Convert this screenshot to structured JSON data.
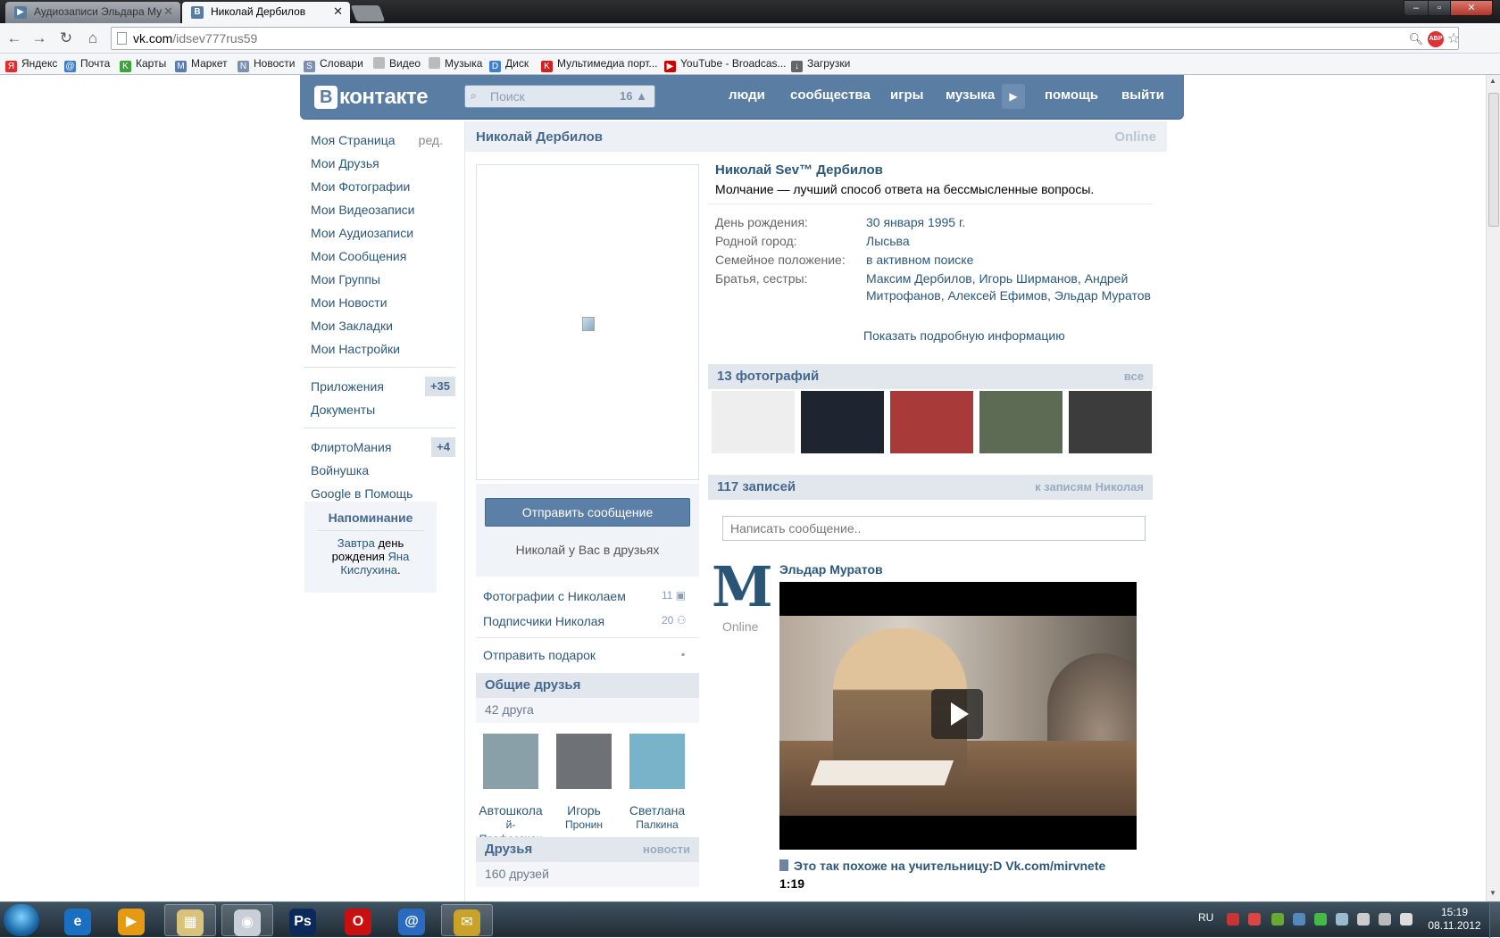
{
  "browser": {
    "tabs": [
      {
        "title": "Аудиозаписи Эльдара Му",
        "favicon": "play-favicon"
      },
      {
        "title": "Николай Дербилов",
        "favicon": "vk-favicon"
      }
    ],
    "nav": {
      "back": "←",
      "forward": "→",
      "reload": "↻",
      "home": "⌂"
    },
    "url": {
      "host": "vk.com",
      "path": "/idsev777rus59"
    },
    "bookmarks": [
      {
        "label": "Яндекс",
        "color": "#e32b2b",
        "glyph": "Я"
      },
      {
        "label": "Почта",
        "color": "#3d7fd1",
        "glyph": "@"
      },
      {
        "label": "Карты",
        "color": "#3aa33a",
        "glyph": "K"
      },
      {
        "label": "Маркет",
        "color": "#5b7ab0",
        "glyph": "M"
      },
      {
        "label": "Новости",
        "color": "#7c8fb0",
        "glyph": "N"
      },
      {
        "label": "Словари",
        "color": "#7c8fb0",
        "glyph": "S"
      },
      {
        "label": "Видео",
        "color": "#bbbbbb",
        "glyph": ""
      },
      {
        "label": "Музыка",
        "color": "#bbbbbb",
        "glyph": ""
      },
      {
        "label": "Диск",
        "color": "#3d7fd1",
        "glyph": "D"
      },
      {
        "label": "Мультимедиа порт...",
        "color": "#d42020",
        "glyph": "K"
      },
      {
        "label": "YouTube - Broadcas...",
        "color": "#cc0000",
        "glyph": "▶"
      },
      {
        "label": "Загрузки",
        "color": "#666666",
        "glyph": "↓"
      }
    ]
  },
  "vk": {
    "logo": "контакте",
    "logo_letter": "В",
    "search": {
      "placeholder": "Поиск",
      "count": "16"
    },
    "topnav": [
      "люди",
      "сообщества",
      "игры",
      "музыка",
      "помощь",
      "выйти"
    ],
    "menu": [
      {
        "label": "Моя Страница",
        "edit": "ред."
      },
      {
        "label": "Мои Друзья"
      },
      {
        "label": "Мои Фотографии"
      },
      {
        "label": "Мои Видеозаписи"
      },
      {
        "label": "Мои Аудиозаписи"
      },
      {
        "label": "Мои Сообщения"
      },
      {
        "label": "Мои Группы"
      },
      {
        "label": "Мои Новости"
      },
      {
        "label": "Мои Закладки"
      },
      {
        "label": "Мои Настройки"
      }
    ],
    "apps": [
      {
        "label": "Приложения",
        "badge": "+35"
      },
      {
        "label": "Документы"
      }
    ],
    "games": [
      {
        "label": "ФлиртоМания",
        "badge": "+4"
      },
      {
        "label": "Войнушка"
      },
      {
        "label": "Google в Помощь"
      }
    ],
    "reminder": {
      "title": "Напоминание",
      "w1": "Завтра",
      "w2": " день рождения ",
      "w3": "Яна Кислухина",
      "w4": "."
    }
  },
  "profile": {
    "name": "Николай Дербилов",
    "online": "Online",
    "full_name": "Николай Sev™ Дербилов",
    "status": "Молчание — лучший способ ответа на бессмысленные вопросы.",
    "info": [
      {
        "key": "День рождения:",
        "value": "30 января 1995 г."
      },
      {
        "key": "Родной город:",
        "value": "Лысьва"
      },
      {
        "key": "Семейное положение:",
        "value": "в активном поиске"
      },
      {
        "key": "Братья, сестры:",
        "value": "Максим Дербилов, Игорь Ширманов, Андрей Митрофанов, Алексей Ефимов, Эльдар Муратов"
      }
    ],
    "show_more": "Показать подробную информацию",
    "send_message": "Отправить сообщение",
    "in_friends": "Николай у Вас в друзьях",
    "links": [
      {
        "label": "Фотографии с Николаем",
        "count": "11",
        "icon": "camera-icon"
      },
      {
        "label": "Подписчики Николая",
        "count": "20",
        "icon": "followers-icon"
      },
      {
        "label": "Отправить подарок",
        "count": "",
        "icon": "gift-icon"
      }
    ],
    "common_friends": {
      "title": "Общие друзья",
      "count": "42 друга",
      "people": [
        {
          "first": "Автошкола",
          "last": "й-Профессион",
          "color": "#8aa0a8"
        },
        {
          "first": "Игорь",
          "last": "Пронин",
          "color": "#6e7277"
        },
        {
          "first": "Светлана",
          "last": "Палкина",
          "color": "#79b3c9"
        }
      ]
    },
    "friends": {
      "title": "Друзья",
      "link": "новости",
      "count": "160 друзей"
    },
    "photos": {
      "title": "13 фотографий",
      "link": "все",
      "thumbs": [
        "#eeeeee",
        "#1f2530",
        "#a93a3a",
        "#5d6b55",
        "#3c3c3c"
      ]
    },
    "wall": {
      "title": "117 записей",
      "link": "к записям Николая",
      "placeholder": "Написать сообщение.."
    },
    "post": {
      "author": "Эльдар Муратов",
      "online": "Online",
      "avatar_glyph": "M",
      "video_title": "Это так похоже на учительницу:D Vk.com/mirvnete",
      "duration": "1:19"
    }
  },
  "taskbar": {
    "apps": [
      "e",
      "▶",
      "▦",
      "◉",
      "Ps",
      "O",
      "@",
      "✉"
    ],
    "lang": "RU",
    "time": "15:19",
    "date": "08.11.2012"
  },
  "colors": {
    "vk_blue": "#597da3",
    "link": "#2b587a",
    "head": "#45688e"
  }
}
